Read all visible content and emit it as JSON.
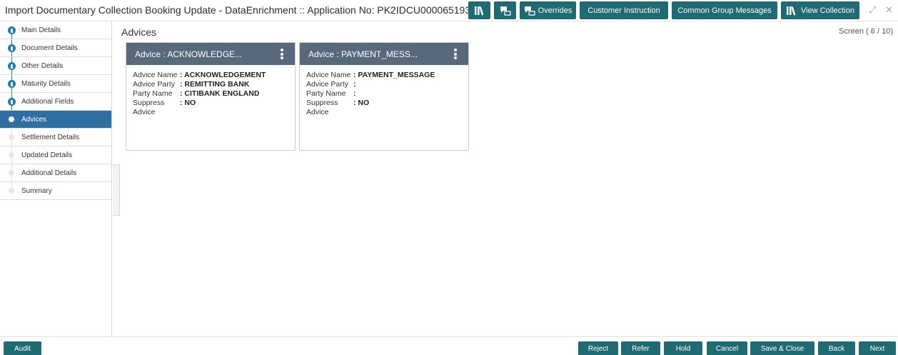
{
  "header": {
    "title": "Import Documentary Collection Booking Update - DataEnrichment :: Application No: PK2IDCU000065193",
    "buttons": {
      "library_icon": "library-icon",
      "chat_icon": "chat-icon",
      "overrides": "Overrides",
      "customer_instruction": "Customer Instruction",
      "common_group_messages": "Common Group Messages",
      "view_collection": "View Collection"
    },
    "minimize_glyph": "⤢",
    "close_glyph": "✕"
  },
  "sidebar": {
    "items": [
      {
        "label": "Main Details",
        "state": "done"
      },
      {
        "label": "Document Details",
        "state": "done"
      },
      {
        "label": "Other Details",
        "state": "done"
      },
      {
        "label": "Maturity Details",
        "state": "done"
      },
      {
        "label": "Additional Fields",
        "state": "done"
      },
      {
        "label": "Advices",
        "state": "active"
      },
      {
        "label": "Settlement Details",
        "state": "pending"
      },
      {
        "label": "Updated Details",
        "state": "pending"
      },
      {
        "label": "Additional Details",
        "state": "pending"
      },
      {
        "label": "Summary",
        "state": "pending"
      }
    ]
  },
  "main": {
    "title": "Advices",
    "screen_indicator": "Screen ( 6 / 10)",
    "cards": [
      {
        "header": "Advice : ACKNOWLEDGE...",
        "advice_name_label": "Advice Name",
        "advice_name_value": ": ACKNOWLEDGEMENT",
        "advice_party_label": "Advice Party",
        "advice_party_value": ": REMITTING BANK",
        "party_name_label": "Party Name",
        "party_name_value": ": CITIBANK ENGLAND",
        "suppress_label": "Suppress",
        "suppress_value": ": NO",
        "suppress_label_2": "Advice"
      },
      {
        "header": "Advice : PAYMENT_MESS...",
        "advice_name_label": "Advice Name",
        "advice_name_value": ": PAYMENT_MESSAGE",
        "advice_party_label": "Advice Party",
        "advice_party_value": ":",
        "party_name_label": "Party Name",
        "party_name_value": ":",
        "suppress_label": "Suppress",
        "suppress_value": ": NO",
        "suppress_label_2": "Advice"
      }
    ]
  },
  "footer": {
    "audit": "Audit",
    "reject": "Reject",
    "refer": "Refer",
    "hold": "Hold",
    "cancel": "Cancel",
    "save_close": "Save & Close",
    "back": "Back",
    "next": "Next"
  },
  "colors": {
    "accent": "#1e6b73",
    "active_nav": "#2d6fa3",
    "card_header": "#59697c",
    "step_done": "#1c7fb0"
  }
}
